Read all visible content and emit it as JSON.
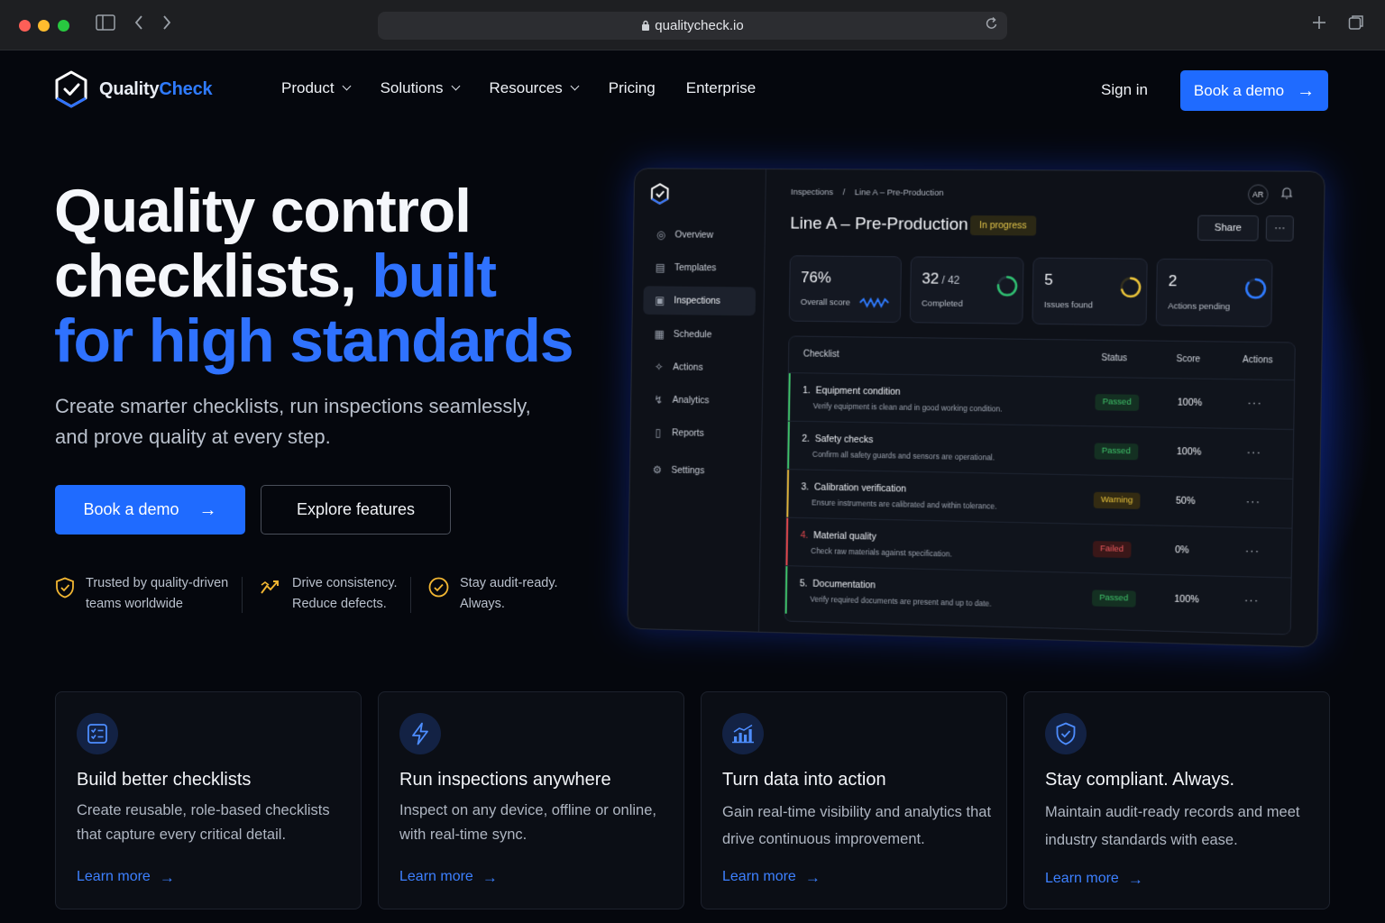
{
  "browser": {
    "url": "qualitycheck.io"
  },
  "brand": {
    "name_part1": "Quality",
    "name_part2": "Check"
  },
  "nav": {
    "items": [
      "Product",
      "Solutions",
      "Resources",
      "Pricing",
      "Enterprise"
    ],
    "sign_in": "Sign in",
    "demo": "Book a demo"
  },
  "hero": {
    "title_line1": "Quality control",
    "title_line2_a": "checklists, ",
    "title_line2_b": "built",
    "title_line3": "for high standards",
    "subtitle": "Create smarter checklists, run inspections seamlessly, and prove quality at every step.",
    "primary_cta": "Book a demo",
    "secondary_cta": "Explore features",
    "trust": [
      {
        "line1": "Trusted by quality-driven",
        "line2": "teams worldwide"
      },
      {
        "line1": "Drive consistency.",
        "line2": "Reduce defects."
      },
      {
        "line1": "Stay audit-ready.",
        "line2": "Always."
      }
    ]
  },
  "dashboard": {
    "sidebar": [
      "Overview",
      "Templates",
      "Inspections",
      "Schedule",
      "Actions",
      "Analytics",
      "Reports",
      "Settings"
    ],
    "active_item": "Inspections",
    "breadcrumb_root": "Inspections",
    "breadcrumb_sep": "/",
    "breadcrumb_current": "Line A – Pre-Production",
    "title": "Line A – Pre-Production",
    "status": "In progress",
    "avatar": "AR",
    "share": "Share",
    "more": "···",
    "kpis": [
      {
        "value": "76%",
        "sub": "",
        "label": "Overall score"
      },
      {
        "value": "32",
        "sub": " / 42",
        "label": "Completed",
        "progress": 0.76
      },
      {
        "value": "5",
        "sub": "",
        "label": "Issues found",
        "progress": 0.7
      },
      {
        "value": "2",
        "sub": "",
        "label": "Actions pending",
        "progress": 0.85
      }
    ],
    "table": {
      "headers": {
        "checklist": "Checklist",
        "status": "Status",
        "score": "Score",
        "actions": "Actions"
      },
      "rows": [
        {
          "num": "1.",
          "name": "Equipment condition",
          "desc": "Verify equipment is clean and in good working condition.",
          "status": "Passed",
          "score": "100%",
          "actions": "···"
        },
        {
          "num": "2.",
          "name": "Safety checks",
          "desc": "Confirm all safety guards and sensors are operational.",
          "status": "Passed",
          "score": "100%",
          "actions": "···"
        },
        {
          "num": "3.",
          "name": "Calibration verification",
          "desc": "Ensure instruments are calibrated and within tolerance.",
          "status": "Warning",
          "score": "50%",
          "actions": "···"
        },
        {
          "num": "4.",
          "name": "Material quality",
          "desc": "Check raw materials against specification.",
          "status": "Failed",
          "score": "0%",
          "actions": "···"
        },
        {
          "num": "5.",
          "name": "Documentation",
          "desc": "Verify required documents are present and up to date.",
          "status": "Passed",
          "score": "100%",
          "actions": "···"
        }
      ]
    }
  },
  "features": [
    {
      "icon": "checklist-icon",
      "title": "Build better checklists",
      "desc": "Create reusable, role-based checklists that capture every critical detail.",
      "link": "Learn more"
    },
    {
      "icon": "lightning-icon",
      "title": "Run inspections anywhere",
      "desc": "Inspect on any device, offline or online, with real-time sync.",
      "link": "Learn more"
    },
    {
      "icon": "analytics-icon",
      "title": "Turn data into action",
      "desc": "Gain real-time visibility and analytics that drive continuous improvement.",
      "link": "Learn more"
    },
    {
      "icon": "shield-check-icon",
      "title": "Stay compliant. Always.",
      "desc": "Maintain audit-ready records and meet industry standards with ease.",
      "link": "Learn more"
    }
  ],
  "colors": {
    "accent": "#1f6bff",
    "passed": "#3fc36a",
    "warning": "#e0b43a",
    "failed": "#e5484d",
    "trust_icon": "#f2b632"
  }
}
